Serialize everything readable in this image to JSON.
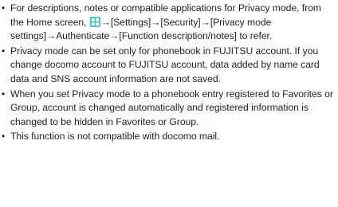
{
  "notes": [
    {
      "bullet": "•",
      "text_before_icon": "For descriptions, notes or compatible applications for Privacy mode, from the Home screen, ",
      "icon": "menu-grid-icon",
      "text_after_icon": "→[Settings]→[Security]→[Privacy mode settings]→Authenticate→[Function description/notes] to refer."
    },
    {
      "bullet": "•",
      "text": "Privacy mode can be set only for phonebook in FUJITSU account. If you change docomo account to FUJITSU account, data added by name card data and SNS account information are not saved."
    },
    {
      "bullet": "•",
      "text": "When you set Privacy mode to a phonebook entry registered to Favorites or Group, account is changed automatically and registered information is changed to be hidden in Favorites or Group."
    },
    {
      "bullet": "•",
      "text": "This function is not compatible with docomo mail."
    }
  ],
  "colors": {
    "text": "#231f20",
    "icon_fill": "#5bc0c9"
  }
}
